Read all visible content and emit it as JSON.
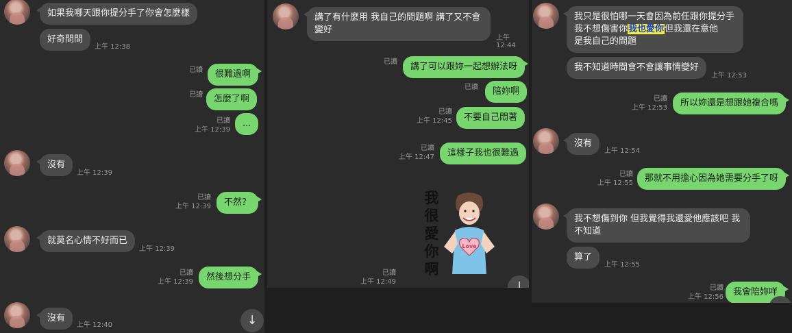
{
  "read_label": "已讀",
  "panel1": {
    "messages": [
      {
        "text": "如果我哪天跟你提分手了你會怎麼樣"
      },
      {
        "text": "好奇問問",
        "time": "上午 12:38"
      },
      {
        "text": "很難過啊"
      },
      {
        "text": "怎麼了啊"
      },
      {
        "text": "...",
        "time": "上午 12:39"
      },
      {
        "text": "沒有",
        "time": "上午 12:39"
      },
      {
        "text": "不然？",
        "time": "上午 12:39"
      },
      {
        "text": "就莫名心情不好而已",
        "time": "上午 12:39"
      },
      {
        "text": "然後想分手",
        "time": "上午 12:39"
      },
      {
        "text": "沒有",
        "time": "上午 12:40"
      }
    ],
    "scroll_icon": "↓"
  },
  "panel2": {
    "messages": [
      {
        "text": "講了有什麼用 我自己的問題啊 講了又不會變好",
        "time": "上午 12:44"
      },
      {
        "text": "講了可以跟妳一起想辦法呀"
      },
      {
        "text": "陪妳啊"
      },
      {
        "text": "不要自己悶著",
        "time": "上午 12:45"
      },
      {
        "text": "這樣子我也很難過",
        "time": "上午 12:47"
      }
    ],
    "sticker": {
      "text": "我很愛你啊",
      "shirt_text": "Love",
      "time": "上午 12:49"
    },
    "scroll_icon": "↓"
  },
  "panel3": {
    "messages": [
      {
        "text_before": "我只是很怕哪一天會因為前任跟你提分手",
        "text_line2_before": "我不想傷害你",
        "highlight": "我也愛你",
        "text_line2_after": "但我還在意他",
        "text_line3": "是我自己的問題"
      },
      {
        "text": "我不知道時間會不會讓事情變好",
        "time": "上午 12:53"
      },
      {
        "text": "所以妳還是想跟她複合嗎",
        "time": "上午 12:53"
      },
      {
        "text": "沒有",
        "time": "上午 12:54"
      },
      {
        "text": "那就不用擔心因為她需要分手了呀",
        "time": "上午 12:55"
      },
      {
        "text": "我不想傷到你 但我覺得我還愛他應該吧 我不知道"
      },
      {
        "text": "算了",
        "time": "上午 12:55"
      },
      {
        "text": "我會陪妳咩",
        "time": "上午 12:56"
      }
    ]
  }
}
